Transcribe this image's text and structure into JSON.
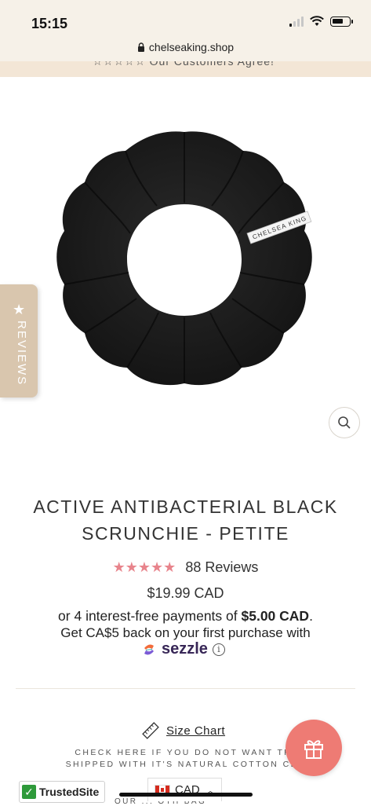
{
  "status_bar": {
    "time": "15:15",
    "battery_level": 0.7
  },
  "browser": {
    "url": "chelseaking.shop"
  },
  "promo": {
    "text": "☆☆☆☆☆ Our Customers Agree!"
  },
  "reviews_tab": {
    "label": "REVIEWS",
    "icon": "star-icon"
  },
  "product": {
    "image_tag_text": "CHELSEA KING",
    "title_line1": "ACTIVE ANTIBACTERIAL BLACK",
    "title_line2": "SCRUNCHIE - PETITE",
    "stars": "★★★★★",
    "rating": 5,
    "review_count": "88 Reviews",
    "price": "$19.99 CAD",
    "installments_prefix": "or 4 interest-free payments of ",
    "installments_amount": "$5.00 CAD",
    "installments_suffix": ".",
    "cashback": "Get CA$5 back on your first purchase with",
    "sezzle_brand": "sezzle",
    "info_symbol": "i"
  },
  "size_chart": {
    "label": "Size Chart"
  },
  "check_text": {
    "line1": "CHECK HERE IF YOU DO NOT WANT THI",
    "line2": "SHIPPED WITH IT'S NATURAL COTTON CLO"
  },
  "trusted_site": {
    "label": "TrustedSite",
    "check": "✓"
  },
  "currency": {
    "code": "CAD"
  },
  "partial_text": "OUR ... OTH BAG",
  "colors": {
    "accent_pink": "#e8848c",
    "gift_button": "#ee7b74",
    "reviews_tab": "#d9c6ae",
    "top_bar": "#f6f1e8",
    "sezzle_purple": "#382757"
  }
}
